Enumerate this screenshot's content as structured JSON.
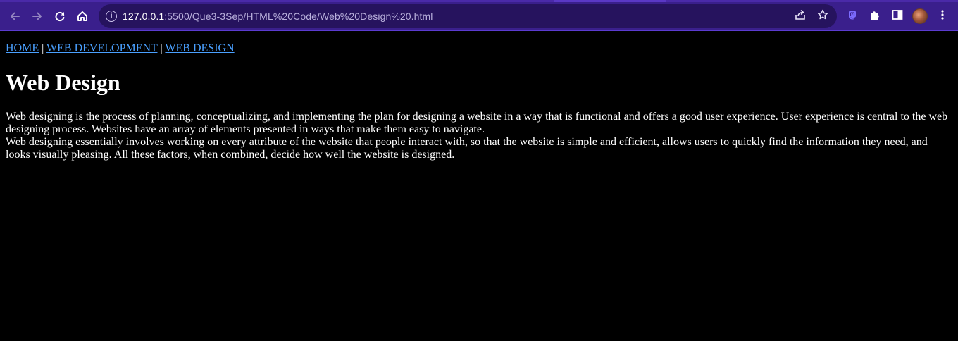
{
  "browser": {
    "url_host": "127.0.0.1",
    "url_path": ":5500/Que3-3Sep/HTML%20Code/Web%20Design%20.html",
    "icons": {
      "back": "arrow-left-icon",
      "forward": "arrow-right-icon",
      "reload": "reload-icon",
      "home": "home-icon",
      "site_info": "info-icon",
      "share": "share-icon",
      "bookmark": "star-icon",
      "extension_1": "mastodon-icon",
      "extensions": "puzzle-icon",
      "side_panel": "sidepanel-icon",
      "profile": "avatar",
      "menu": "kebab-menu-icon"
    },
    "colors": {
      "chrome": "#3a1f8c",
      "omnibox": "#26135e"
    }
  },
  "page": {
    "nav": {
      "home": "HOME",
      "web_development": "WEB DEVELOPMENT",
      "web_design": "WEB DESIGN",
      "separator": "|"
    },
    "heading": "Web Design",
    "paragraph_1": "Web designing is the process of planning, conceptualizing, and implementing the plan for designing a website in a way that is functional and offers a good user experience. User experience is central to the web designing process. Websites have an array of elements presented in ways that make them easy to navigate.",
    "paragraph_2": "Web designing essentially involves working on every attribute of the website that people interact with, so that the website is simple and efficient, allows users to quickly find the information they need, and looks visually pleasing. All these factors, when combined, decide how well the website is designed.",
    "colors": {
      "background": "#000000",
      "text": "#ffffff",
      "link": "#4aa0ff"
    }
  }
}
